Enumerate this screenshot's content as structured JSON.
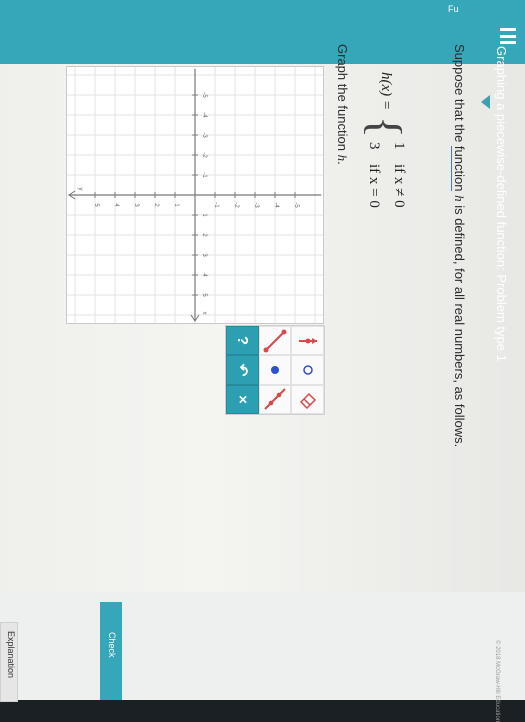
{
  "header": {
    "section_title": "Functions",
    "title": "Graphing a piecewise-defined function: Problem type 1",
    "menu_icon": "hamburger-menu-icon"
  },
  "question": {
    "intro_before": "Suppose that the ",
    "glossary_word": "function",
    "intro_func": "h",
    "intro_after": " is defined, for all real numbers, as follows.",
    "formula": {
      "lhs": "h(x) =",
      "rows": [
        {
          "value": "1",
          "condition": "if x ≠ 0"
        },
        {
          "value": "3",
          "condition": "if x = 0"
        }
      ]
    },
    "prompt_before": "Graph the function ",
    "prompt_func": "h",
    "prompt_after": "."
  },
  "graph": {
    "x_axis_label": "x",
    "y_axis_label": "y",
    "x_ticks": [
      "-5",
      "-4",
      "-3",
      "-2",
      "-1",
      "1",
      "2",
      "3",
      "4",
      "5"
    ],
    "y_ticks": [
      "-5",
      "-4",
      "-3",
      "-2",
      "-1",
      "1",
      "2",
      "3",
      "4",
      "5"
    ],
    "x_range": [
      -6,
      6
    ],
    "y_range": [
      -6,
      6
    ]
  },
  "tools": {
    "items": [
      {
        "name": "line-segment-tool-icon"
      },
      {
        "name": "ray-tool-icon"
      },
      {
        "name": "eraser-icon"
      },
      {
        "name": "filled-point-icon",
        "color": "#2f4fd1"
      },
      {
        "name": "open-point-icon",
        "color": "#2f4fd1"
      },
      {
        "name": "line-tool-icon"
      }
    ],
    "clear_label": "×",
    "undo_label": "↶",
    "help_label": "?"
  },
  "colors": {
    "accent": "#35a7b9",
    "tool_red": "#d84a4a"
  },
  "footer": {
    "explanation_label": "Explanation",
    "check_label": "Check",
    "copyright": "© 2018 McGraw-Hill Education"
  }
}
